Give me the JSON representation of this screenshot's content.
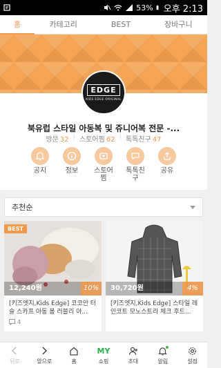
{
  "status_bar": {
    "battery": "53%",
    "time": "오후 2:13"
  },
  "tabs": [
    {
      "label": "홈",
      "active": true
    },
    {
      "label": "카테고리",
      "active": false
    },
    {
      "label": "BEST",
      "active": false
    },
    {
      "label": "장바구니",
      "active": false
    }
  ],
  "shop": {
    "logo_text": "EDGE",
    "logo_subtext": "KIDS EDGE ORIGINAL",
    "title": "북유럽 스타일 아동복 및 쥬니어복 전문 -...",
    "stats": [
      {
        "label": "방문",
        "value": "32"
      },
      {
        "label": "스토어찜",
        "value": "62"
      },
      {
        "label": "톡톡친구",
        "value": "47"
      }
    ]
  },
  "actions": [
    {
      "label": "공지",
      "icon": "bell-icon"
    },
    {
      "label": "정보",
      "icon": "info-icon"
    },
    {
      "label": "스토어\n찜",
      "icon": "store-heart-icon"
    },
    {
      "label": "톡톡친\n구",
      "icon": "chat-icon"
    },
    {
      "label": "공유",
      "icon": "share-icon"
    }
  ],
  "sort": {
    "selected": "추천순"
  },
  "products": [
    {
      "badge": "BEST",
      "price": "12,240원",
      "discount": "10%",
      "name": "[키즈엣지,Kids Edge] 코코안 터\n슬 스카프 아동 봄 러블리 아...",
      "reviews": "4"
    },
    {
      "badge": "",
      "price": "30,720원",
      "discount": "4%",
      "name": "[키즈엣지,Kids Edge] 스타일 레\n인코트 모노스트리 체크 후드...",
      "reviews": ""
    }
  ],
  "bottom_nav": [
    {
      "label": "뒤로",
      "icon": "back-arrow-icon",
      "disabled": true
    },
    {
      "label": "앞으로",
      "icon": "forward-arrow-icon",
      "disabled": false
    },
    {
      "label": "홈",
      "icon": "home-icon",
      "disabled": false
    },
    {
      "label": "쇼핑",
      "icon": "my-shopping-icon",
      "badge_text": "MY",
      "disabled": false
    },
    {
      "label": "초대",
      "icon": "add-user-icon",
      "disabled": false
    },
    {
      "label": "알림",
      "icon": "notification-bell-icon",
      "disabled": false
    },
    {
      "label": "설정",
      "icon": "gear-icon",
      "disabled": false
    }
  ],
  "colors": {
    "accent": "#f39a4a",
    "banner": "#f3a455",
    "nav_green": "#2bb24c"
  }
}
